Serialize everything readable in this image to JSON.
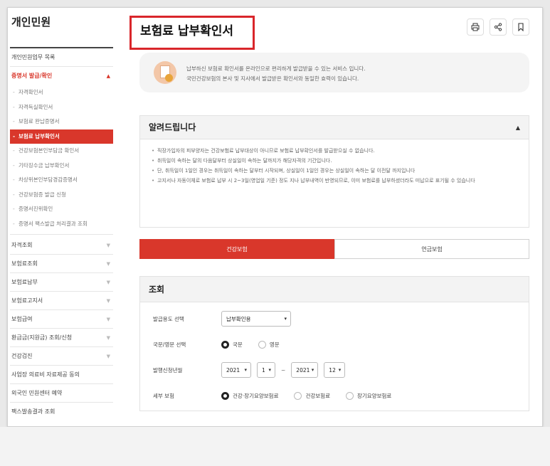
{
  "sidebar": {
    "title": "개인민원",
    "items": [
      {
        "label": "개인민원업무 목록",
        "active": false,
        "arrow": ""
      },
      {
        "label": "증명서 발급/확인",
        "active": true,
        "arrow": "▲"
      }
    ],
    "sub_items": [
      {
        "label": "자격확인서"
      },
      {
        "label": "자격득실확인서"
      },
      {
        "label": "보험료 완납증명서"
      },
      {
        "label": "보험료 납부확인서",
        "selected": true
      },
      {
        "label": "건강보험본인부담금 확인서"
      },
      {
        "label": "기타징수금 납부확인서"
      },
      {
        "label": "차상위본인부담경감증명서"
      },
      {
        "label": "건강보험증 발급 신청"
      },
      {
        "label": "증명서진위확인"
      },
      {
        "label": "증명서 팩스발급 처리결과 조회"
      }
    ],
    "more_items": [
      {
        "label": "자격조회",
        "arrow": "▼"
      },
      {
        "label": "보험료조회",
        "arrow": "▼"
      },
      {
        "label": "보험료납부",
        "arrow": "▼"
      },
      {
        "label": "보험료고지서",
        "arrow": "▼"
      },
      {
        "label": "보험급여",
        "arrow": "▼"
      },
      {
        "label": "환급금(지원금) 조회/신청",
        "arrow": "▼"
      },
      {
        "label": "건강검진",
        "arrow": "▼"
      },
      {
        "label": "사업장 의료비 자료제공 동의",
        "arrow": ""
      },
      {
        "label": "외국인 민원센터 예약",
        "arrow": ""
      },
      {
        "label": "팩스발송결과 조회",
        "arrow": ""
      }
    ]
  },
  "header": {
    "title": "보험료 납부확인서"
  },
  "intro": {
    "line1": "납부하신 보험료 확인서를 온라인으로 편리하게 발급받을 수 있는 서비스 입니다.",
    "line2": "국민건강보험의 본사 및 지사에서 발급받은 확인서와 동일한 효력이 있습니다."
  },
  "notice": {
    "title": "알려드립니다",
    "caret": "▲",
    "items": [
      "직장가입자의 피부양자는 건강보험료 납부대상이 아니므로 보험료 납부확인서를 발급받으실 수 없습니다.",
      "취득일이 속하는 달의 다음달부터 상실일이 속하는 달까지가 해당자격의 기간입니다.",
      "단, 취득일이 1일인 경우는 취득일이 속하는 달부터 시작되며, 상실일이 1일인 경우는 상실일이 속하는 달 이전달 까지입니다",
      "고지서나 자동이체로 보험료 납부 시 2~3일(영업일 기준) 정도 지나 납부내역이 반영되므로, 이미 보험료를 납부하셨더라도 미납으로 표기될 수 있습니다"
    ]
  },
  "tabs": [
    {
      "label": "건강보험",
      "active": true
    },
    {
      "label": "연금보험",
      "active": false
    }
  ],
  "query": {
    "title": "조회",
    "purpose_label": "발급용도 선택",
    "purpose_value": "납부확인용",
    "lang_label": "국문/영문 선택",
    "lang_options": [
      "국문",
      "영문"
    ],
    "lang_selected": "국문",
    "period_label": "발행신청년월",
    "from_year": "2021",
    "from_month": "1",
    "tilde": "~",
    "to_year": "2021",
    "to_month": "12",
    "detail_label": "세부 보험",
    "detail_options": [
      "건강·장기요양보험료",
      "건강보험료",
      "장기요양보험료"
    ],
    "detail_selected": "건강·장기요양보험료"
  },
  "colors": {
    "accent": "#d9372b",
    "highlight_border": "#d9262b"
  }
}
